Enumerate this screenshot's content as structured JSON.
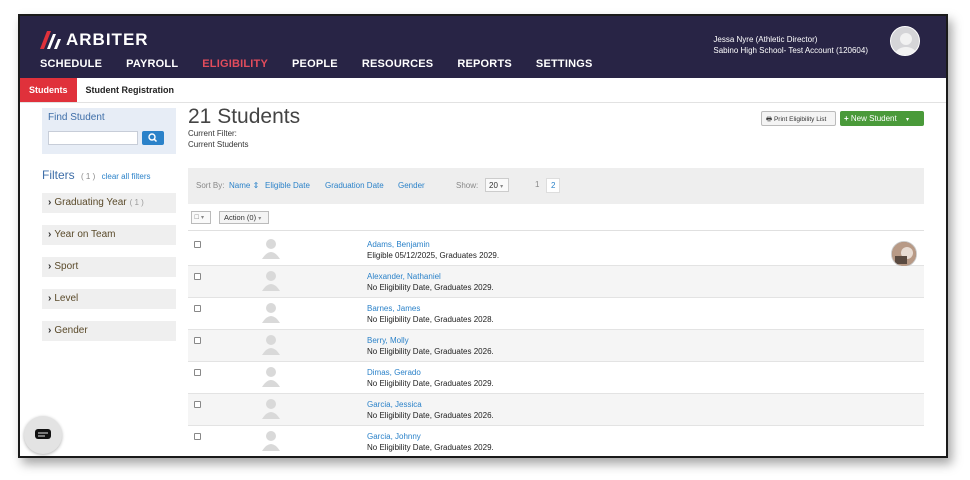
{
  "brand": {
    "name": "ARBITER",
    "accent": "#e0313b",
    "header_bg": "#282445"
  },
  "nav": [
    {
      "label": "SCHEDULE"
    },
    {
      "label": "PAYROLL"
    },
    {
      "label": "ELIGIBILITY",
      "active": true
    },
    {
      "label": "PEOPLE"
    },
    {
      "label": "RESOURCES"
    },
    {
      "label": "REPORTS"
    },
    {
      "label": "SETTINGS"
    }
  ],
  "user": {
    "name": "Jessa Nyre (Athletic Director)",
    "account": "Sabino High School- Test Account (120604)"
  },
  "subtabs": [
    {
      "label": "Students",
      "active": true
    },
    {
      "label": "Student Registration"
    }
  ],
  "sidebar": {
    "find_label": "Find Student",
    "filters_title": "Filters",
    "filters_count": "( 1 )",
    "clear_label": "clear all filters",
    "filters": [
      {
        "label": "Graduating Year",
        "count": "( 1 )"
      },
      {
        "label": "Year on Team",
        "count": ""
      },
      {
        "label": "Sport",
        "count": ""
      },
      {
        "label": "Level",
        "count": ""
      },
      {
        "label": "Gender",
        "count": ""
      }
    ]
  },
  "main": {
    "title": "21 Students",
    "current_filter_label": "Current Filter:",
    "current_filter_value": "Current Students",
    "print_button": "Print Eligibility List",
    "new_button": "New Student",
    "sort_by_label": "Sort By:",
    "sort_options": [
      "Name",
      "Eligible Date",
      "Graduation Date",
      "Gender"
    ],
    "show_label": "Show:",
    "show_value": "20",
    "pages": [
      "1",
      "2"
    ],
    "current_page": "2",
    "action_label": "Action (0)"
  },
  "students": [
    {
      "name": "Adams, Benjamin",
      "info": "Eligible 05/12/2025, Graduates 2029.",
      "has_photo": true
    },
    {
      "name": "Alexander, Nathaniel",
      "info": "No Eligibility Date, Graduates 2029."
    },
    {
      "name": "Barnes, James",
      "info": "No Eligibility Date, Graduates 2028."
    },
    {
      "name": "Berry, Molly",
      "info": "No Eligibility Date, Graduates 2026."
    },
    {
      "name": "Dimas, Gerado",
      "info": "No Eligibility Date, Graduates 2029."
    },
    {
      "name": "Garcia, Jessica",
      "info": "No Eligibility Date, Graduates 2026."
    },
    {
      "name": "Garcia, Johnny",
      "info": "No Eligibility Date, Graduates 2029."
    }
  ]
}
